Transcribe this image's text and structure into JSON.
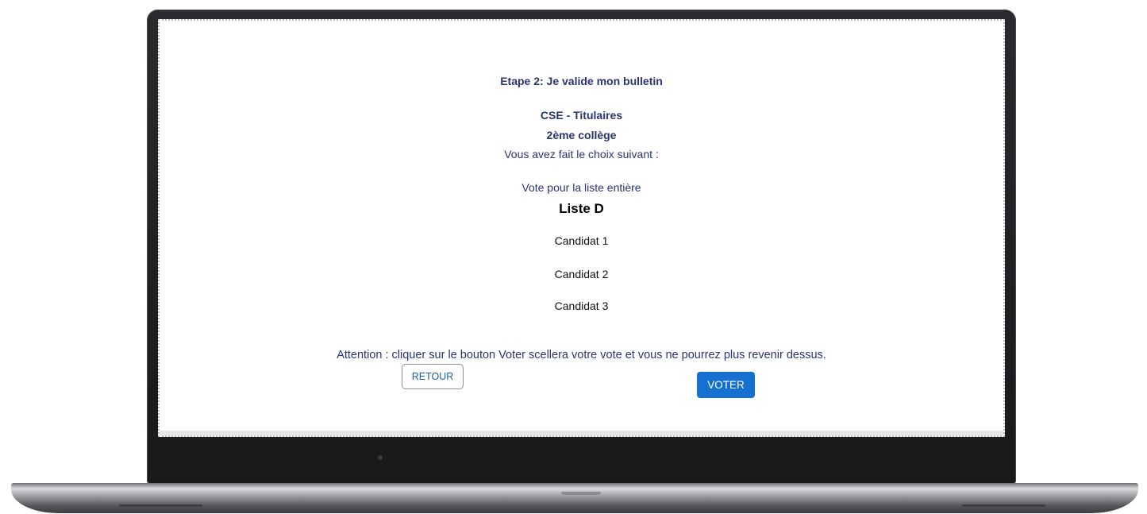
{
  "ballot": {
    "step_title": "Etape 2: Je valide mon bulletin",
    "election_name": "CSE - Titulaires",
    "college": "2ème collège",
    "choice_intro": "Vous avez fait le choix suivant :",
    "vote_type": "Vote pour la liste entière",
    "list_name": "Liste D",
    "candidates": [
      "Candidat 1",
      "Candidat 2",
      "Candidat 3"
    ],
    "warning": "Attention : cliquer sur le bouton Voter scellera votre vote et vous ne pourrez plus revenir dessus."
  },
  "actions": {
    "back_label": "RETOUR",
    "vote_label": "VOTER"
  },
  "colors": {
    "text_primary": "#2b3472",
    "vote_button": "#1670cf",
    "back_button_text": "#1d5f9e"
  }
}
